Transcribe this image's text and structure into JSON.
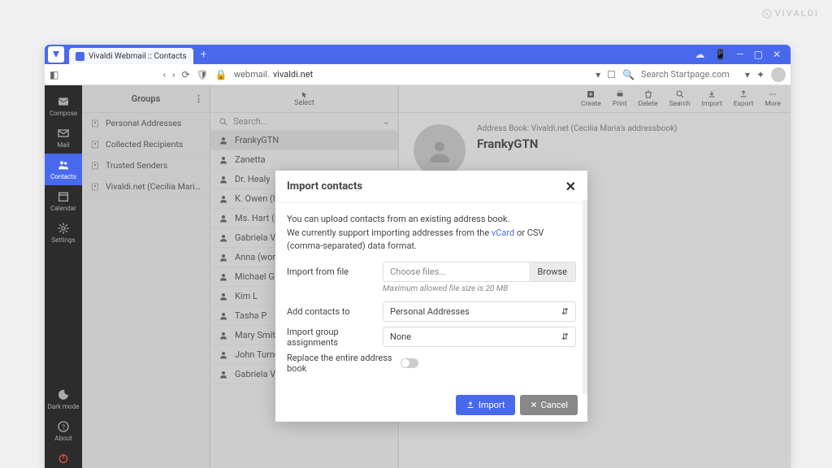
{
  "brand": "VIVALDI",
  "tab_title": "Vivaldi Webmail :: Contacts",
  "url_prefix": "webmail.",
  "url_domain": "vivaldi.net",
  "search_placeholder": "Search Startpage.com",
  "rail": {
    "compose": "Compose",
    "mail": "Mail",
    "contacts": "Contacts",
    "calendar": "Calendar",
    "settings": "Settings",
    "darkmode": "Dark mode",
    "about": "About"
  },
  "groups": {
    "header": "Groups",
    "items": [
      "Personal Addresses",
      "Collected Recipients",
      "Trusted Senders",
      "Vivaldi.net (Cecilia Maria's addr..."
    ]
  },
  "contacts_panel": {
    "select": "Select",
    "search": "Search...",
    "items": [
      "FrankyGTN",
      "Zanetta",
      "Dr. Healy",
      "K. Owen (land",
      "Ms. Hart (sch",
      "Gabriela V",
      "Anna (work)",
      "Michael G",
      "Kim L",
      "Tasha P",
      "Mary Smith",
      "John Turner",
      "Gabriela V"
    ]
  },
  "toolbar": {
    "create": "Create",
    "print": "Print",
    "delete": "Delete",
    "search": "Search",
    "import": "Import",
    "export": "Export",
    "more": "More"
  },
  "detail": {
    "breadcrumb": "Address Book: Vivaldi.net (Cecilia Maria's addressbook)",
    "name": "FrankyGTN"
  },
  "modal": {
    "title": "Import contacts",
    "desc1": "You can upload contacts from an existing address book.",
    "desc2a": "We currently support importing addresses from the ",
    "desc2_link": "vCard",
    "desc2b": " or CSV (comma-separated) data format.",
    "import_from": "Import from file",
    "choose": "Choose files...",
    "browse": "Browse",
    "hint": "Maximum allowed file size is 20 MB",
    "add_to": "Add contacts to",
    "add_to_val": "Personal Addresses",
    "group_assign": "Import group assignments",
    "group_assign_val": "None",
    "replace": "Replace the entire address book",
    "import_btn": "Import",
    "cancel_btn": "Cancel"
  }
}
